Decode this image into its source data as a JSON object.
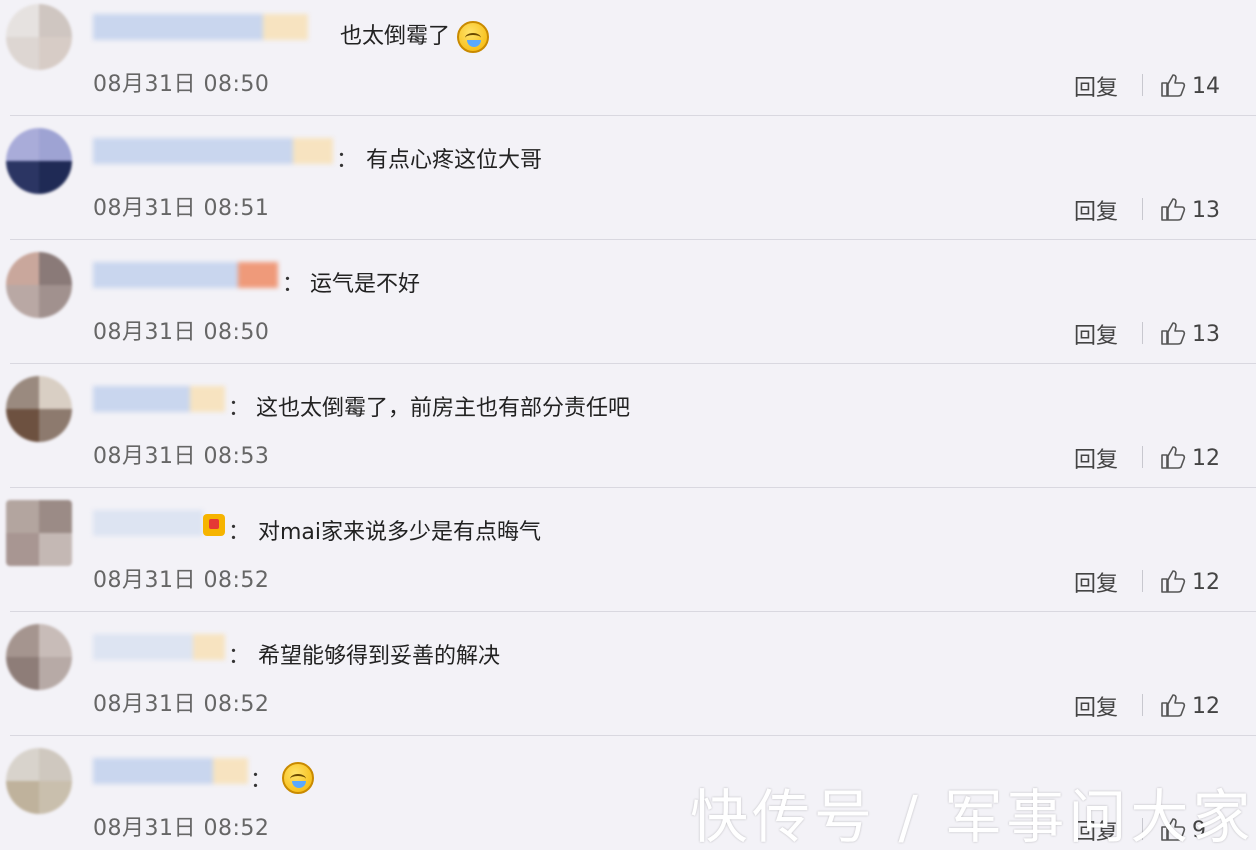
{
  "comments": [
    {
      "colon": "",
      "text": "也太倒霉了",
      "emoji": "cry-laugh",
      "time": "08月31日 08:50",
      "reply": "回复",
      "likes": "14"
    },
    {
      "colon": "：",
      "text": "有点心疼这位大哥",
      "emoji": "",
      "time": "08月31日 08:51",
      "reply": "回复",
      "likes": "13"
    },
    {
      "colon": "：",
      "text": "运气是不好",
      "emoji": "",
      "time": "08月31日 08:50",
      "reply": "回复",
      "likes": "13"
    },
    {
      "colon": "：",
      "text": "这也太倒霉了，前房主也有部分责任吧",
      "emoji": "",
      "time": "08月31日 08:53",
      "reply": "回复",
      "likes": "12"
    },
    {
      "colon": "：",
      "text": "对mai家来说多少是有点晦气",
      "emoji": "",
      "time": "08月31日 08:52",
      "reply": "回复",
      "likes": "12"
    },
    {
      "colon": "：",
      "text": "希望能够得到妥善的解决",
      "emoji": "",
      "time": "08月31日 08:52",
      "reply": "回复",
      "likes": "12"
    },
    {
      "colon": "：",
      "text": "",
      "emoji": "cry-laugh",
      "time": "08月31日 08:52",
      "reply": "回复",
      "likes": "9"
    }
  ],
  "watermark": "快传号 / 军事问大家",
  "colors": {
    "background": "#f3f2f7",
    "divider": "#d9d8e0",
    "text": "#222222",
    "meta": "#666666"
  }
}
